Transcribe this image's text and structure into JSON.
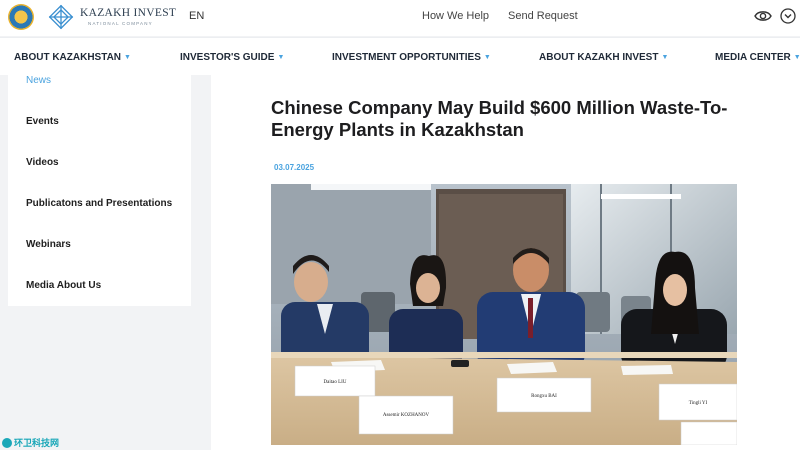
{
  "header": {
    "logo_title": "KAZAKH INVEST",
    "logo_subtitle": "NATIONAL COMPANY",
    "language": "EN",
    "links": [
      "How We Help",
      "Send Request"
    ]
  },
  "nav": {
    "items": [
      "ABOUT KAZAKHSTAN",
      "INVESTOR'S GUIDE",
      "INVESTMENT OPPORTUNITIES",
      "ABOUT KAZAKH INVEST",
      "MEDIA CENTER"
    ]
  },
  "sidebar": {
    "items": [
      "News",
      "Events",
      "Videos",
      "Publicatons and Presentations",
      "Webinars",
      "Media About Us"
    ],
    "active_index": 0
  },
  "article": {
    "title": "Chinese Company May Build $600 Million Waste-To-Energy Plants in Kazakhstan",
    "date": "03.07.2025",
    "photo_nameplates": [
      "Daitao LIU",
      "Assemir KOZHANOV",
      "Rongxu BAI",
      "Tingli YI"
    ]
  },
  "watermark": {
    "text": "环卫科技网"
  },
  "colors": {
    "accent": "#4aa3df",
    "text_dark": "#1d1d1f",
    "background": "#f2f3f5"
  },
  "icons": {
    "accessibility": "eye-icon",
    "user_menu": "chevron-circle-icon",
    "nav_dropdown": "caret-down-icon"
  }
}
